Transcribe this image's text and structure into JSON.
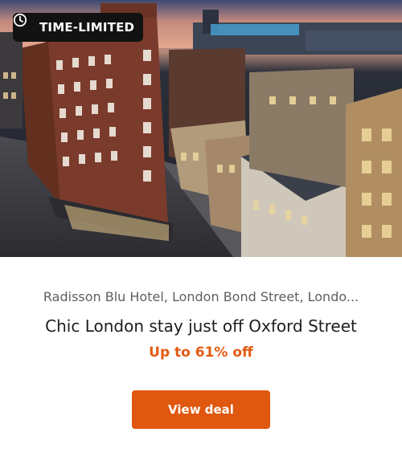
{
  "hero": {
    "badge_label": "TIME-LIMITED",
    "badge_icon": "clock-icon",
    "image_subject": "london-hotel-aerial-dusk"
  },
  "deal": {
    "location": "Radisson Blu Hotel, London Bond Street, Londo...",
    "title": "Chic London stay just off Oxford Street",
    "discount": "Up to 61% off",
    "cta_label": "View deal"
  },
  "colors": {
    "accent": "#e0580f",
    "discount_text": "#e35a12",
    "badge_bg": "#121212"
  }
}
